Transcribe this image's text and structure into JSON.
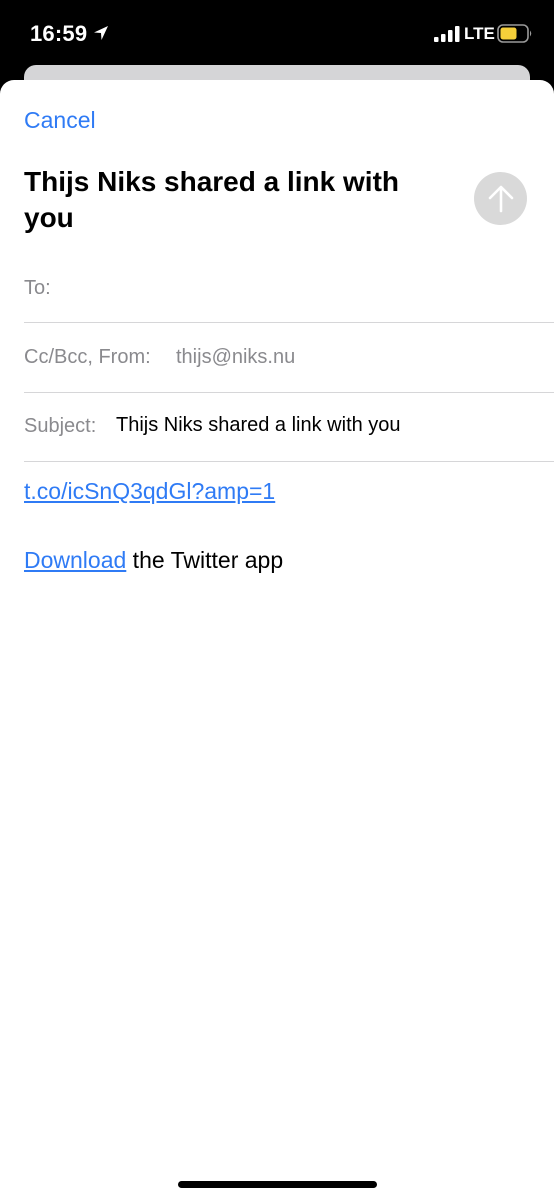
{
  "status_bar": {
    "time": "16:59",
    "network": "LTE",
    "battery_color": "#f5cf3a"
  },
  "compose": {
    "cancel_label": "Cancel",
    "title": "Thijs Niks shared a link with you",
    "send_icon": "arrow-up-icon",
    "to_label": "To:",
    "cc_from_label": "Cc/Bcc, From:",
    "from_value": "thijs@niks.nu",
    "subject_label": "Subject:",
    "subject_value": "Thijs Niks shared a link with you",
    "body_link": "t.co/icSnQ3qdGl?amp=1",
    "download_link": "Download",
    "download_suffix": " the Twitter app"
  },
  "colors": {
    "accent": "#2f7bf5",
    "label_gray": "#8a8a8e",
    "send_disabled": "#d9d9d9"
  }
}
